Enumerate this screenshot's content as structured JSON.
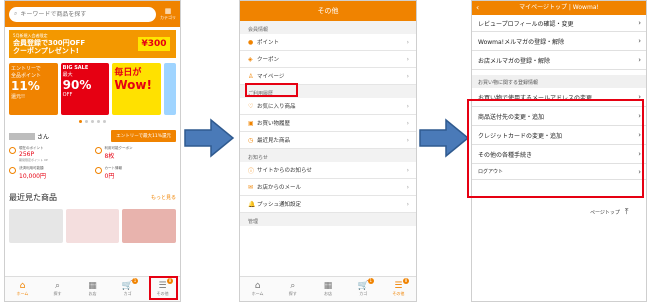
{
  "colors": {
    "accent": "#f08300",
    "highlight": "#e60012"
  },
  "phone1": {
    "search_placeholder": "キーワードで商品を探す",
    "category_label": "カテゴリ",
    "banner": {
      "small": "5月新規入会者限定",
      "line1": "会員登録で300円OFF",
      "line2": "クーポンプレゼント!",
      "ticket": "¥300"
    },
    "campaigns": [
      {
        "top": "エントリーで",
        "mid": "全品ポイント",
        "num": "11%",
        "bottom": "還元!!"
      },
      {
        "top": "BIG SALE",
        "mid": "最大",
        "num": "90%",
        "bottom": "OFF"
      },
      {
        "top": "毎日が",
        "mid": "Wow!",
        "num": "",
        "bottom": ""
      },
      {
        "top": "",
        "mid": "",
        "num": "",
        "bottom": ""
      }
    ],
    "user_suffix": "さん",
    "entry_button": "エントリーで最大11%還元",
    "stats": [
      {
        "label": "現在のポイント",
        "value": "256P",
        "sub": "期間限定ポイント 0P"
      },
      {
        "label": "利用可能クーポン",
        "value": "8枚",
        "sub": ""
      },
      {
        "label": "決済利用可能額",
        "value": "10,000円",
        "sub": ""
      },
      {
        "label": "カート情報",
        "value": "0円",
        "sub": ""
      }
    ],
    "recent_title": "最近見た商品",
    "recent_more": "もっと見る"
  },
  "tabs": [
    {
      "icon": "⌂",
      "label": "ホーム",
      "badge": ""
    },
    {
      "icon": "⌕",
      "label": "探す",
      "badge": ""
    },
    {
      "icon": "▦",
      "label": "お店",
      "badge": ""
    },
    {
      "icon": "🛒",
      "label": "カゴ",
      "badge": "1"
    },
    {
      "icon": "☰",
      "label": "その他",
      "badge": "8"
    }
  ],
  "phone2": {
    "title": "その他",
    "sections": [
      {
        "title": "会員情報",
        "items": [
          {
            "icon": "●",
            "label": "ポイント"
          },
          {
            "icon": "◈",
            "label": "クーポン"
          },
          {
            "icon": "♙",
            "label": "マイページ"
          }
        ]
      },
      {
        "title": "ご利用履歴",
        "items": [
          {
            "icon": "♡",
            "label": "お気に入り商品"
          },
          {
            "icon": "▣",
            "label": "お買い物履歴"
          },
          {
            "icon": "◷",
            "label": "最近見た商品"
          }
        ]
      },
      {
        "title": "お知らせ",
        "items": [
          {
            "icon": "ⓘ",
            "label": "サイトからのお知らせ"
          },
          {
            "icon": "✉",
            "label": "お店からのメール"
          },
          {
            "icon": "🔔",
            "label": "プッシュ通知設定"
          }
        ]
      },
      {
        "title": "管理",
        "items": []
      }
    ]
  },
  "phone3": {
    "title": "マイページトップ | Wowma!",
    "rows_top": [
      "レビュープロフィールの確認・変更",
      "Wowma!メルマガの登録・解除",
      "お店メルマガの登録・解除"
    ],
    "section": "お買い物に関する登録情報",
    "rows_main": [
      "お買い物で使用するメールアドレスの変更",
      "商品送付先の変更・追加",
      "クレジットカードの変更・追加",
      "その他の各種手続き"
    ],
    "logout": "ログアウト",
    "page_top": "ページトップ"
  }
}
